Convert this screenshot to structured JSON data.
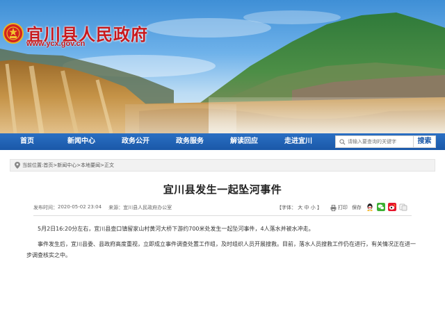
{
  "header": {
    "site_title": "宜川县人民政府",
    "site_url": "www.ycx.gov.cn"
  },
  "nav": {
    "items": [
      "首页",
      "新闻中心",
      "政务公开",
      "政务服务",
      "解读回应",
      "走进宜川"
    ],
    "search_placeholder": "请输入要查询的关键字",
    "search_button": "搜索"
  },
  "breadcrumb": {
    "prefix": "当前位置:",
    "items": [
      "首页",
      "新闻中心",
      "本地要闻",
      "正文"
    ],
    "separator": ">"
  },
  "article": {
    "title": "宜川县发生一起坠河事件",
    "published_label": "发布时间：",
    "published": "2020-05-02 23:04",
    "source_label": "来源：",
    "source": "宜川县人民政府办公室",
    "font_size_label": "【字体：",
    "font_large": "大",
    "font_medium": "中",
    "font_small": "小",
    "font_size_close": "】",
    "print_label": "打印",
    "save_label": "保存",
    "paragraphs": [
      "5月2日16:20分左右，宜川县壶口镇留家山村黄河大桥下游约700米处发生一起坠河事件，4人落水并被水冲走。",
      "事件发生后，宜川县委、县政府高度重视，立即成立事件调查处置工作组，及时组织人员开展搜救。目前，落水人员搜救工作仍在进行，有关情况正在进一步调查核实之中。"
    ]
  },
  "icons": {
    "emblem": "national-emblem-icon",
    "search": "search-icon",
    "location": "location-pin-icon",
    "print": "printer-icon",
    "save": "save-icon",
    "share": [
      "qq-icon",
      "wechat-icon",
      "weibo-icon",
      "more-share-icon"
    ]
  },
  "colors": {
    "nav_bg": "#1a58a8",
    "title_red": "#c8191d"
  }
}
